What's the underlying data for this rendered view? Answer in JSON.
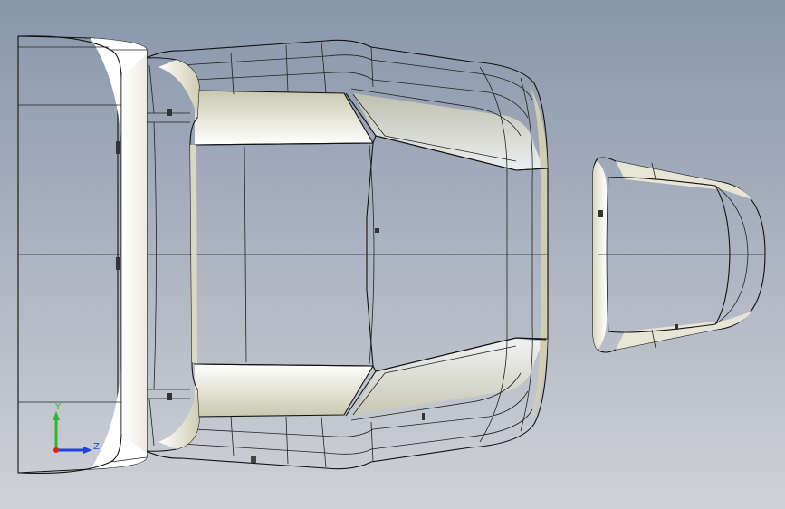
{
  "view": {
    "background_top": "#8996aa",
    "background_bottom": "#cfd1d6",
    "model_color": "#ffffff",
    "shade_color": "#d7d6c1",
    "edge_color": "#111111"
  },
  "triad": {
    "y_label": "Y",
    "z_label": "Z",
    "y_color": "#2fb82f",
    "z_color": "#2244dd",
    "x_color": "#dd2222",
    "icon": "axis-triad-icon"
  }
}
